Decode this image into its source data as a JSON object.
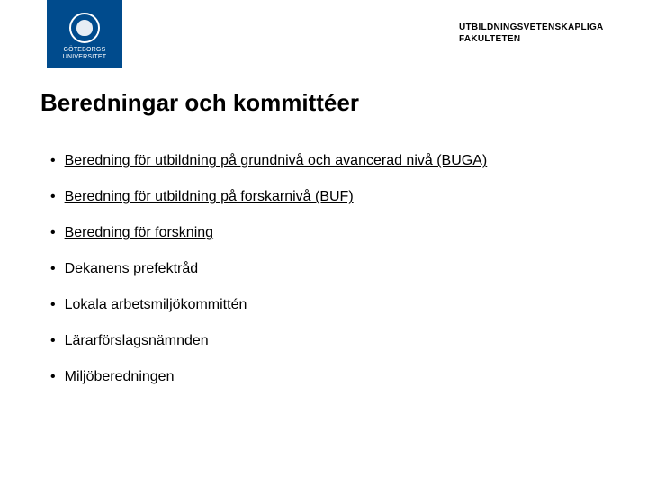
{
  "logo": {
    "line1": "GÖTEBORGS",
    "line2": "UNIVERSITET"
  },
  "faculty": {
    "line1": "UTBILDNINGSVETENSKAPLIGA",
    "line2": "FAKULTETEN"
  },
  "title": "Beredningar och kommittéer",
  "items": [
    {
      "label": "Beredning för utbildning på grundnivå och avancerad nivå (BUGA)"
    },
    {
      "label": "Beredning för utbildning på forskarnivå (BUF)"
    },
    {
      "label": "Beredning för forskning"
    },
    {
      "label": "Dekanens prefektråd"
    },
    {
      "label": "Lokala arbetsmiljökommittén"
    },
    {
      "label": "Lärarförslagsnämnden"
    },
    {
      "label": "Miljöberedningen"
    }
  ]
}
